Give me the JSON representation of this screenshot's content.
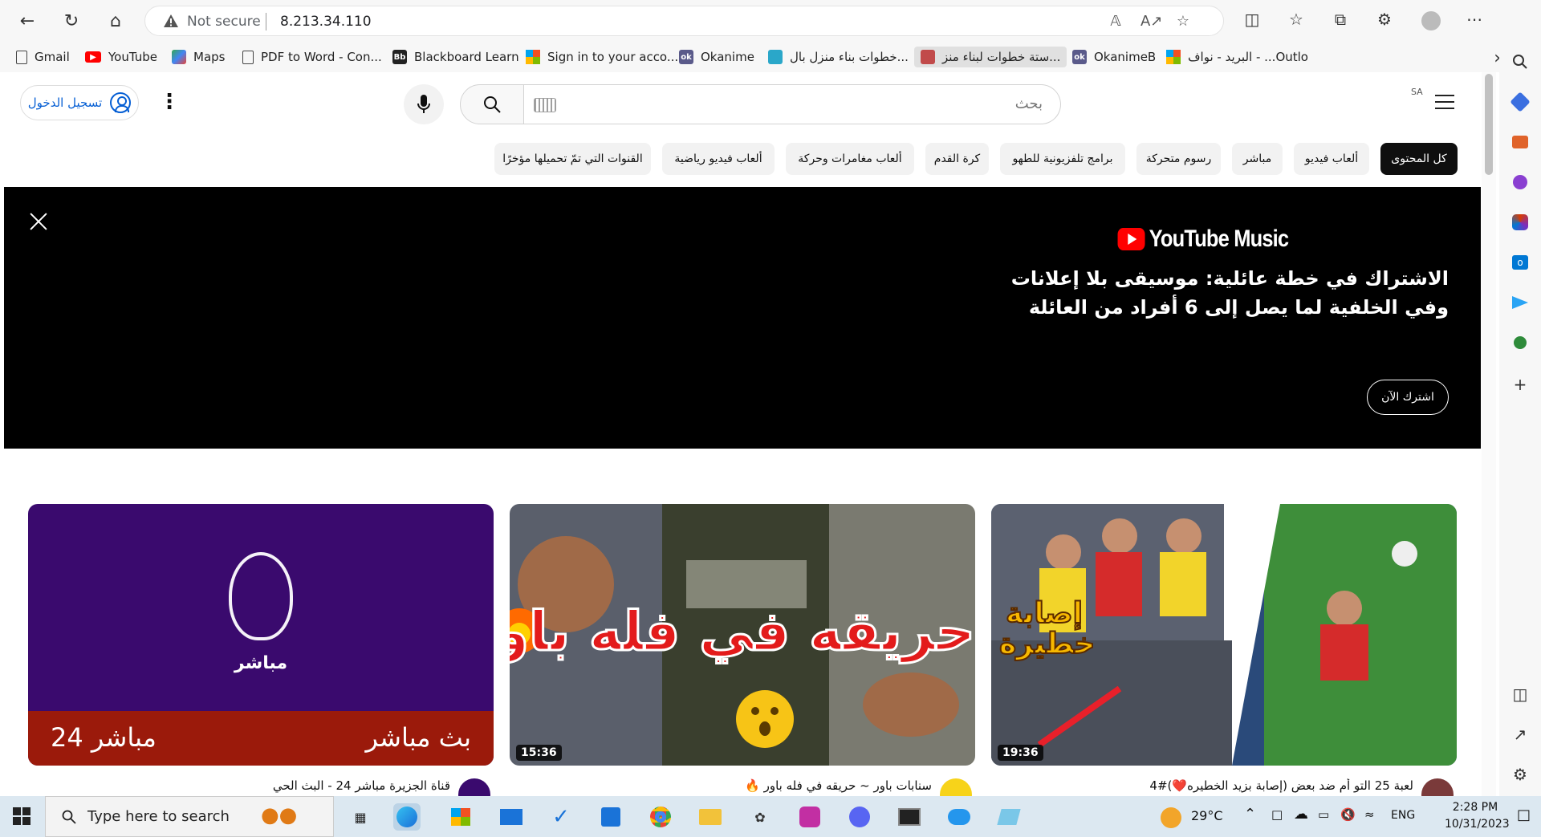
{
  "browser": {
    "address": {
      "security": "Not secure",
      "url": "8.213.34.110"
    },
    "bookmarks": [
      {
        "label": "Gmail",
        "icon": "page-icon"
      },
      {
        "label": "YouTube",
        "icon": "youtube-icon"
      },
      {
        "label": "Maps",
        "icon": "maps-icon"
      },
      {
        "label": "PDF to Word - Con...",
        "icon": "page-icon"
      },
      {
        "label": "Blackboard Learn",
        "icon": "blackboard-icon"
      },
      {
        "label": "Sign in to your acco...",
        "icon": "microsoft-icon"
      },
      {
        "label": "Okanime",
        "icon": "okanime-icon"
      },
      {
        "label": "خطوات بناء منزل بال...",
        "icon": "site-icon"
      },
      {
        "label": "ستة خطوات لبناء منز...",
        "icon": "site-icon"
      },
      {
        "label": "OkanimeB",
        "icon": "okanime-icon"
      },
      {
        "label": "البريد - نواف - ...Outlo",
        "icon": "microsoft-icon"
      }
    ]
  },
  "youtube": {
    "header": {
      "signin_label": "تسجيل الدخول",
      "search_placeholder": "بحث",
      "region": "SA"
    },
    "chips": [
      "كل المحتوى",
      "ألعاب فيديو",
      "مباشر",
      "رسوم متحركة",
      "برامج تلفزيونية للطهو",
      "كرة القدم",
      "ألعاب مغامرات وحركة",
      "ألعاب فيديو رياضية",
      "القنوات التي تمّ تحميلها مؤخرًا"
    ],
    "banner": {
      "brand": "YouTube Music",
      "title": "الاشتراك في خطة عائلية: موسيقى بلا إعلانات وفي الخلفية لما يصل إلى 6 أفراد من العائلة",
      "cta": "اشترك الآن"
    },
    "videos": [
      {
        "thumb_text_1": "إصابة",
        "thumb_text_2": "خطيرة",
        "duration": "19:36",
        "title": "لعبة 25 التو أم ضد بعض (إصابة بزيد الخطيره❤️)#4"
      },
      {
        "thumb_text": "حريقه في فله باور",
        "duration": "15:36",
        "title": "سنابات باور ~ حريقه في فله باور 🔥"
      },
      {
        "logo_text": "مباشر",
        "live_left": "مباشر 24",
        "live_right": "بث مباشر",
        "title": "قناة الجزيرة مباشر 24 - البث الحي"
      }
    ]
  },
  "taskbar": {
    "search_placeholder": "Type here to search",
    "temperature": "29°C",
    "language": "ENG",
    "time": "2:28 PM",
    "date": "10/31/2023"
  },
  "colors": {
    "youtube_red": "#ff0000",
    "link_blue": "#065fd4",
    "jazeera_purple": "#3a0a6e",
    "jazeera_red": "#9b1a0b"
  }
}
